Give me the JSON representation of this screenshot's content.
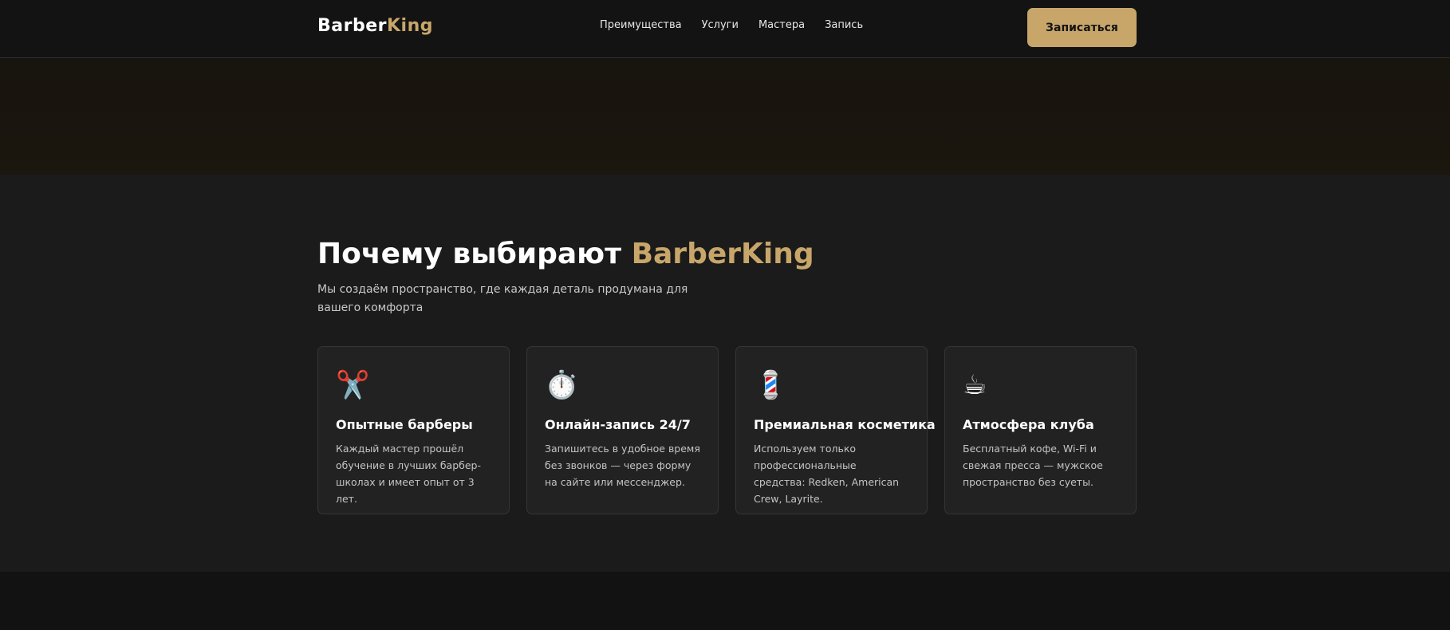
{
  "header": {
    "logo_main": "Barber",
    "logo_accent": "King",
    "nav": [
      "Преимущества",
      "Услуги",
      "Мастера",
      "Запись"
    ],
    "cta_label": "Записаться"
  },
  "features": {
    "title_main": "Почему выбирают ",
    "title_accent": "BarberKing",
    "subtitle": "Мы создаём пространство, где каждая деталь продумана для вашего комфорта",
    "cards": [
      {
        "icon": "scissors-icon",
        "glyph": "✂️",
        "title": "Опытные барберы",
        "text": "Каждый мастер прошёл обучение в лучших барбер-школах и имеет опыт от 3 лет."
      },
      {
        "icon": "stopwatch-icon",
        "glyph": "⏱️",
        "title": "Онлайн-запись 24/7",
        "text": "Запишитесь в удобное время без звонков — через форму на сайте или мессенджер."
      },
      {
        "icon": "barber-pole-icon",
        "glyph": "💈",
        "title": "Премиальная косметика",
        "text": "Используем только профессиональные средства: Redken, American Crew, Layrite."
      },
      {
        "icon": "coffee-icon",
        "glyph": "☕",
        "title": "Атмосфера клуба",
        "text": "Бесплатный кофе, Wi-Fi и свежая пресса — мужское пространство без суеты."
      }
    ]
  },
  "colors": {
    "accent": "#c8a66a",
    "background": "#121212",
    "section_bg": "#1b1b1b",
    "card_bg": "#222222"
  }
}
